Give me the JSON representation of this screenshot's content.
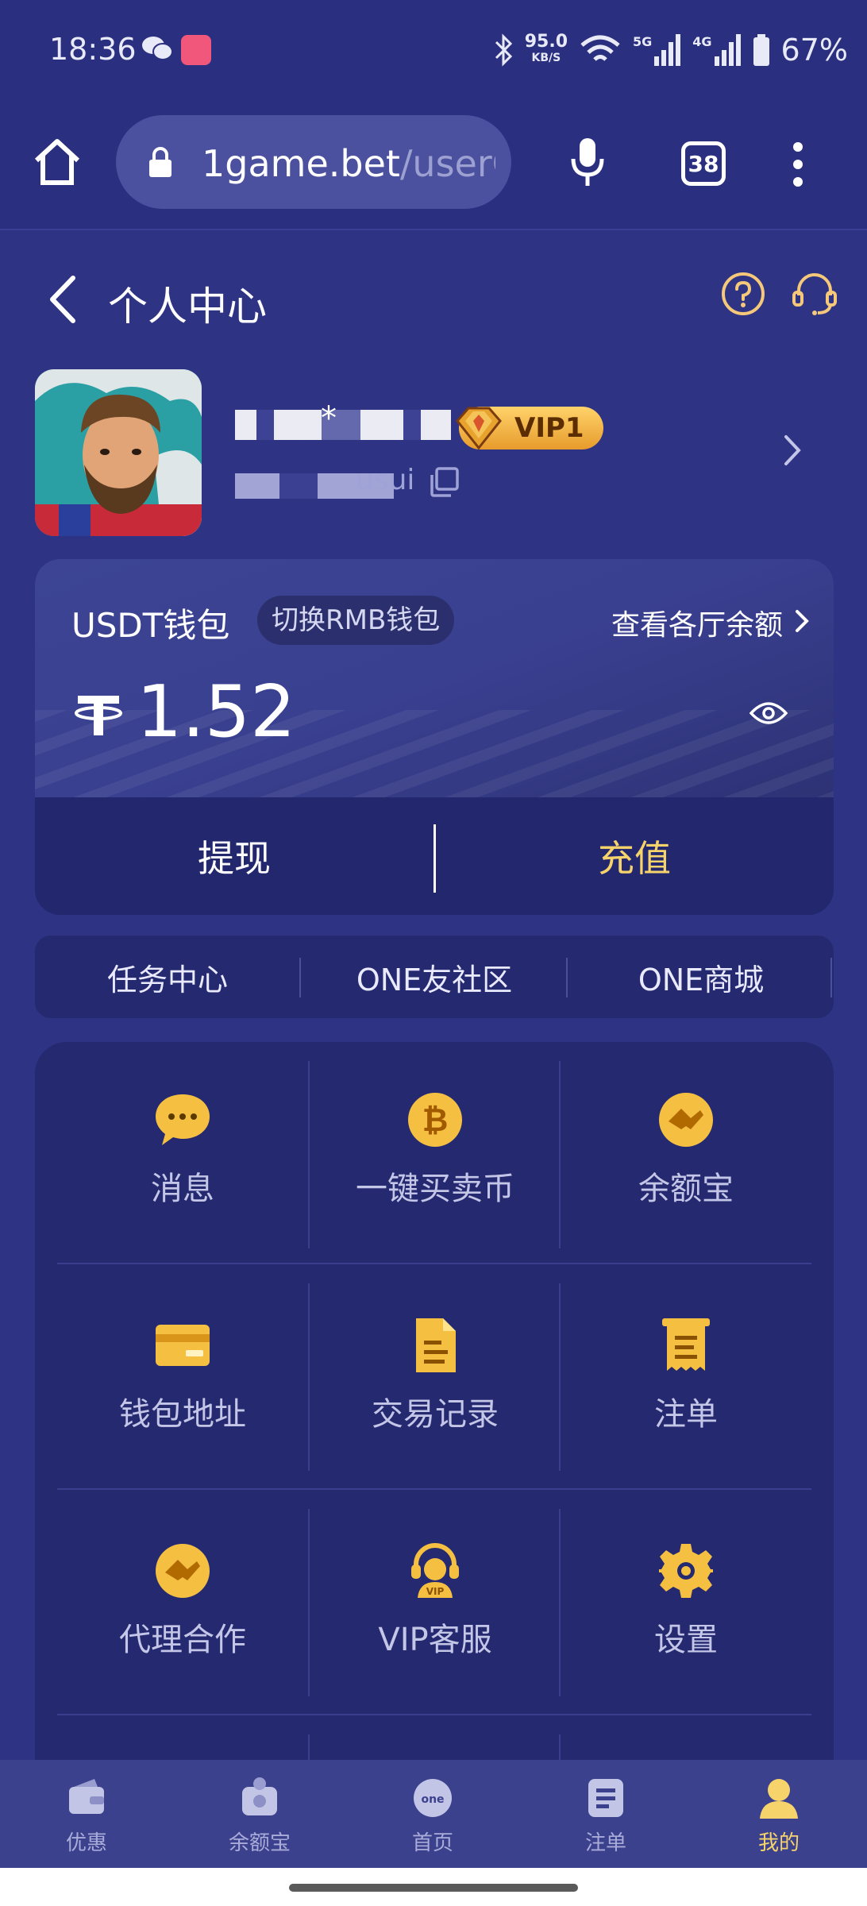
{
  "status_bar": {
    "time": "18:36",
    "net_speed": "95.0",
    "net_speed_unit": "KB/S",
    "net_5g": "5G",
    "net_4g": "4G",
    "battery": "67%"
  },
  "browser": {
    "url_main": "1game.bet",
    "url_path": "/userC",
    "tab_count": "38"
  },
  "header": {
    "title": "个人中心"
  },
  "profile": {
    "username_visible": "*",
    "vip_level": "VIP1",
    "uid_suffix": "usui"
  },
  "wallet": {
    "label": "USDT钱包",
    "switch_label": "切换RMB钱包",
    "balances_link": "查看各厅余额",
    "balance": "1.52",
    "withdraw_label": "提现",
    "deposit_label": "充值"
  },
  "quick_links": [
    "任务中心",
    "ONE友社区",
    "ONE商城"
  ],
  "grid": [
    {
      "label": "消息",
      "icon": "chat-bubble-icon"
    },
    {
      "label": "一键买卖币",
      "icon": "bitcoin-icon"
    },
    {
      "label": "余额宝",
      "icon": "handshake-icon"
    },
    {
      "label": "钱包地址",
      "icon": "card-icon"
    },
    {
      "label": "交易记录",
      "icon": "document-icon"
    },
    {
      "label": "注单",
      "icon": "receipt-icon"
    },
    {
      "label": "代理合作",
      "icon": "handshake-icon"
    },
    {
      "label": "VIP客服",
      "icon": "vip-support-icon"
    },
    {
      "label": "设置",
      "icon": "gear-icon"
    }
  ],
  "bottom_nav": [
    {
      "label": "优惠",
      "icon": "wallet-icon",
      "active": false
    },
    {
      "label": "余额宝",
      "icon": "piggy-icon",
      "active": false
    },
    {
      "label": "首页",
      "icon": "one-logo-icon",
      "active": false
    },
    {
      "label": "注单",
      "icon": "list-icon",
      "active": false
    },
    {
      "label": "我的",
      "icon": "user-icon",
      "active": true
    }
  ],
  "colors": {
    "background": "#2e3384",
    "card": "#25296f",
    "accent_gold": "#f6d36b",
    "icon_gold": "#f5c042"
  }
}
